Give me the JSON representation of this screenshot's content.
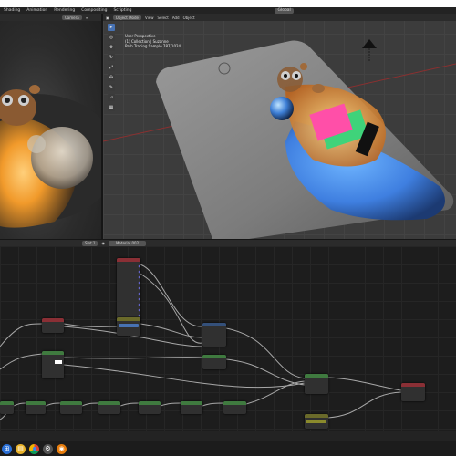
{
  "menu": {
    "items": [
      "Shading",
      "Animation",
      "Rendering",
      "Compositing",
      "Scripting"
    ],
    "camera_select": "Camera",
    "scene_select": "Global"
  },
  "viewport": {
    "mode": "Object Mode",
    "menus": [
      "View",
      "Select",
      "Add",
      "Object"
    ],
    "overlay_lines": [
      "User Perspective",
      "(1) Collection | Suzanne",
      "Path Tracing Sample 787/1024"
    ]
  },
  "node_editor": {
    "slot": "Slot 1",
    "material": "Material.002"
  },
  "colors": {
    "header_red": "#8a2f35",
    "header_green": "#3f7a3f",
    "header_blue": "#34507a",
    "header_purple": "#5a3f73",
    "header_olive": "#6a6a2a",
    "socket_yellow": "#c7c729",
    "socket_gray": "#a1a1a1",
    "socket_blue": "#6363c7",
    "active_tool": "#4772b3"
  },
  "icons": [
    "menu-icon",
    "move-icon",
    "rotate-icon",
    "scale-icon",
    "transform-icon",
    "annotate-icon",
    "measure-icon",
    "camera-icon",
    "chrome-icon",
    "blender-icon",
    "settings-icon"
  ]
}
